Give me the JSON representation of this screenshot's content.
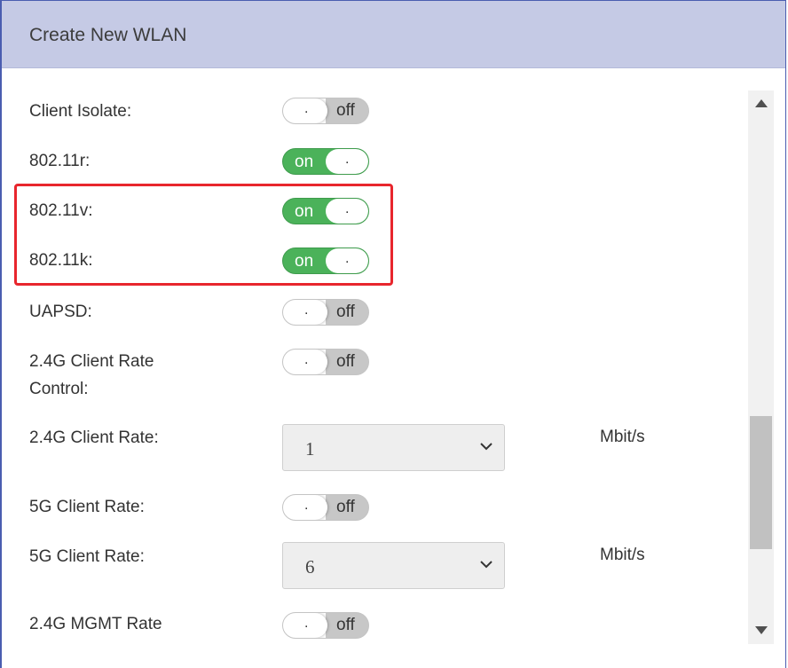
{
  "dialog": {
    "title": "Create New WLAN"
  },
  "form": {
    "client_isolate": {
      "label": "Client Isolate:",
      "state": "off",
      "state_text": "off",
      "knob_text": "."
    },
    "r802_11r": {
      "label": "802.11r:",
      "state": "on",
      "state_text": "on",
      "knob_text": "."
    },
    "r802_11v": {
      "label": "802.11v:",
      "state": "on",
      "state_text": "on",
      "knob_text": "."
    },
    "r802_11k": {
      "label": "802.11k:",
      "state": "on",
      "state_text": "on",
      "knob_text": "."
    },
    "uapsd": {
      "label": "UAPSD:",
      "state": "off",
      "state_text": "off",
      "knob_text": "."
    },
    "client_rate_control_24g": {
      "label_line1": "2.4G Client Rate",
      "label_line2": "Control:",
      "state": "off",
      "state_text": "off",
      "knob_text": "."
    },
    "client_rate_24g": {
      "label": "2.4G Client Rate:",
      "value": "1",
      "unit": "Mbit/s"
    },
    "client_rate_5g_toggle": {
      "label": "5G Client Rate:",
      "state": "off",
      "state_text": "off",
      "knob_text": "."
    },
    "client_rate_5g": {
      "label": "5G Client Rate:",
      "value": "6",
      "unit": "Mbit/s"
    },
    "mgmt_rate_24g": {
      "label": "2.4G MGMT Rate",
      "state": "off",
      "state_text": "off",
      "knob_text": "."
    }
  },
  "colors": {
    "header_bg": "#c5cae5",
    "toggle_on": "#4bb25a",
    "toggle_off": "#c7c7c7",
    "highlight": "#e8262d",
    "border": "#4a5db0"
  },
  "icons": {
    "scroll_up": "triangle-up",
    "scroll_down": "triangle-down",
    "select_arrow": "chevron-down"
  }
}
